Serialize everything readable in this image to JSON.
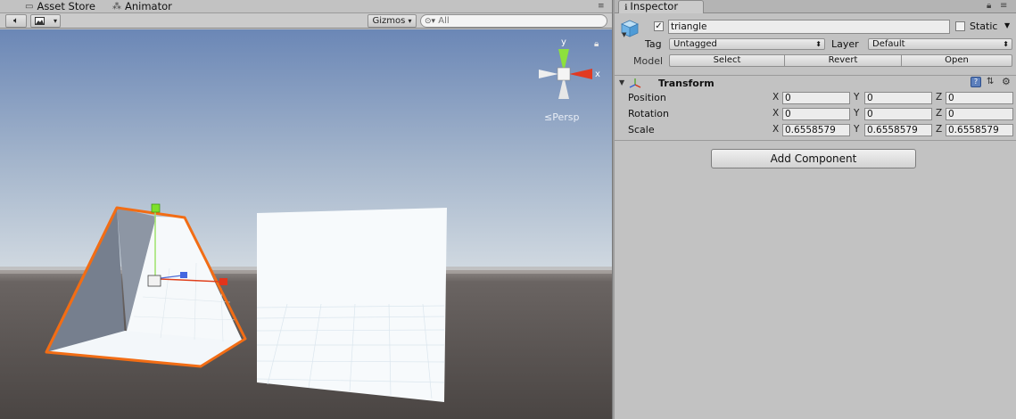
{
  "scene": {
    "tabs": [
      {
        "label": "Asset Store",
        "icon": "shopping-cart-icon"
      },
      {
        "label": "Animator",
        "icon": "animator-icon"
      }
    ],
    "toolbar": {
      "audio_icon": "speaker-icon",
      "effects_icon": "image-icon",
      "gizmos_label": "Gizmos",
      "search_placeholder": "All"
    },
    "orientation_gizmo": {
      "y_label": "y",
      "x_label": "x",
      "projection_label": "Persp"
    },
    "colors": {
      "sky_top": "#6f8cba",
      "horizon": "#c9d4dd",
      "ground": "#5a5553",
      "selection_outline": "#f26d15"
    }
  },
  "inspector": {
    "tab_label": "Inspector",
    "object": {
      "active": true,
      "name": "triangle",
      "static_label": "Static",
      "static_checked": false,
      "tag_label": "Tag",
      "tag_value": "Untagged",
      "layer_label": "Layer",
      "layer_value": "Default",
      "model_label": "Model",
      "model_buttons": [
        "Select",
        "Revert",
        "Open"
      ]
    },
    "transform": {
      "title": "Transform",
      "rows": [
        {
          "label": "Position",
          "x": "0",
          "y": "0",
          "z": "0"
        },
        {
          "label": "Rotation",
          "x": "0",
          "y": "0",
          "z": "0"
        },
        {
          "label": "Scale",
          "x": "0.6558579",
          "y": "0.6558579",
          "z": "0.6558579"
        }
      ],
      "axis_labels": [
        "X",
        "Y",
        "Z"
      ]
    },
    "add_component_label": "Add Component"
  }
}
